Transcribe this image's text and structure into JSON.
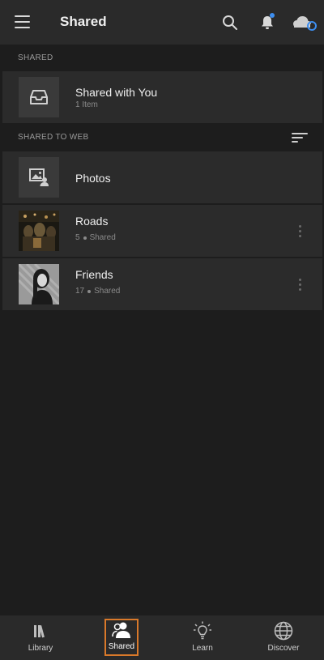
{
  "header": {
    "title": "Shared",
    "notification_dot_color": "#3d8ef0",
    "cloud_sync_color": "#3d8ef0"
  },
  "sections": {
    "shared_label": "SHARED",
    "shared_to_web_label": "SHARED TO WEB"
  },
  "shared_with_you": {
    "name": "Shared with You",
    "count": "1 Item"
  },
  "web_items": [
    {
      "name": "Photos"
    },
    {
      "name": "Roads",
      "count": "5",
      "status": "Shared"
    },
    {
      "name": "Friends",
      "count": "17",
      "status": "Shared"
    }
  ],
  "bottom_nav": [
    {
      "label": "Library",
      "icon": "library-icon"
    },
    {
      "label": "Shared",
      "icon": "shared-icon",
      "active": true
    },
    {
      "label": "Learn",
      "icon": "lightbulb-icon"
    },
    {
      "label": "Discover",
      "icon": "globe-icon"
    }
  ],
  "colors": {
    "background": "#1d1d1d",
    "surface": "#2b2b2b",
    "accent_active_border": "#d9792a"
  }
}
